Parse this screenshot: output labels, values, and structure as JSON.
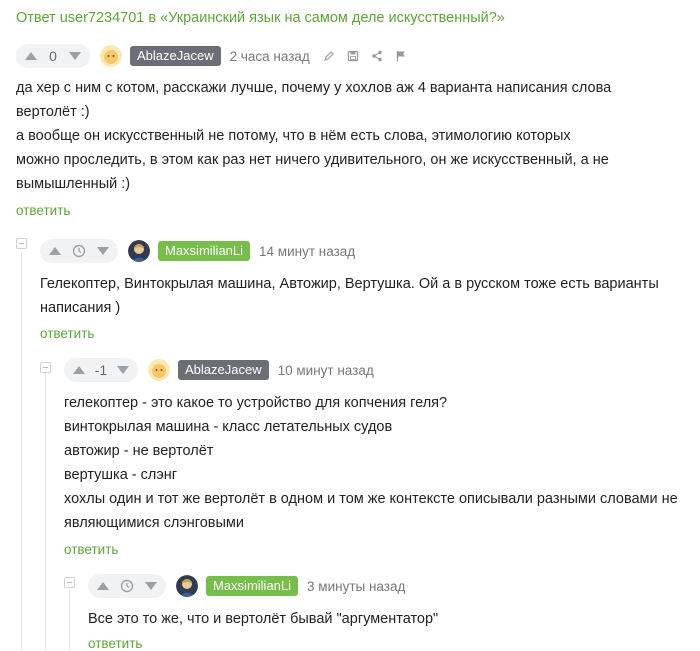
{
  "header": {
    "prefix": "Ответ user7234701 в ",
    "title": "«Украинский язык на самом деле искусственный?»"
  },
  "comments": [
    {
      "votes": "0",
      "author": "AblazeJacew",
      "time": "2 часа назад",
      "lines": [
        "да хер с ним с котом, расскажи лучше, почему у хохлов аж 4 варианта написания слова",
        "вертолёт :)",
        "а вообще он искусственный не потому, что в нём есть слова, этимологию которых",
        "можно проследить, в этом как раз нет ничего удивительного, он же искусственный, а не",
        "вымышленный :)"
      ],
      "reply": "ответить"
    },
    {
      "author": "MaxsimilianLi",
      "time": "14 минут назад",
      "lines": [
        "Гелекоптер, Винтокрылая машина, Автожир, Вертушка. Ой а в русском тоже есть варианты",
        "написания )"
      ],
      "reply": "ответить"
    },
    {
      "votes": "-1",
      "author": "AblazeJacew",
      "time": "10 минут назад",
      "lines": [
        "гелекоптер - это какое то устройство для копчения геля?",
        "винтокрылая машина - класс летательных судов",
        "автожир - не вертолёт",
        "вертушка - слэнг",
        "хохлы один и тот же вертолёт в одном и том же контексте описывали разными словами не",
        "являющимися слэнговыми"
      ],
      "reply": "ответить"
    },
    {
      "author": "MaxsimilianLi",
      "time": "3 минуты назад",
      "lines": [
        "Все это то же, что и вертолёт бывай \"аргументатор\""
      ],
      "reply": "ответить"
    }
  ],
  "colors": {
    "accent": "#5aa634",
    "nick_grey": "#6b6f75",
    "nick_green": "#76bd4a"
  }
}
